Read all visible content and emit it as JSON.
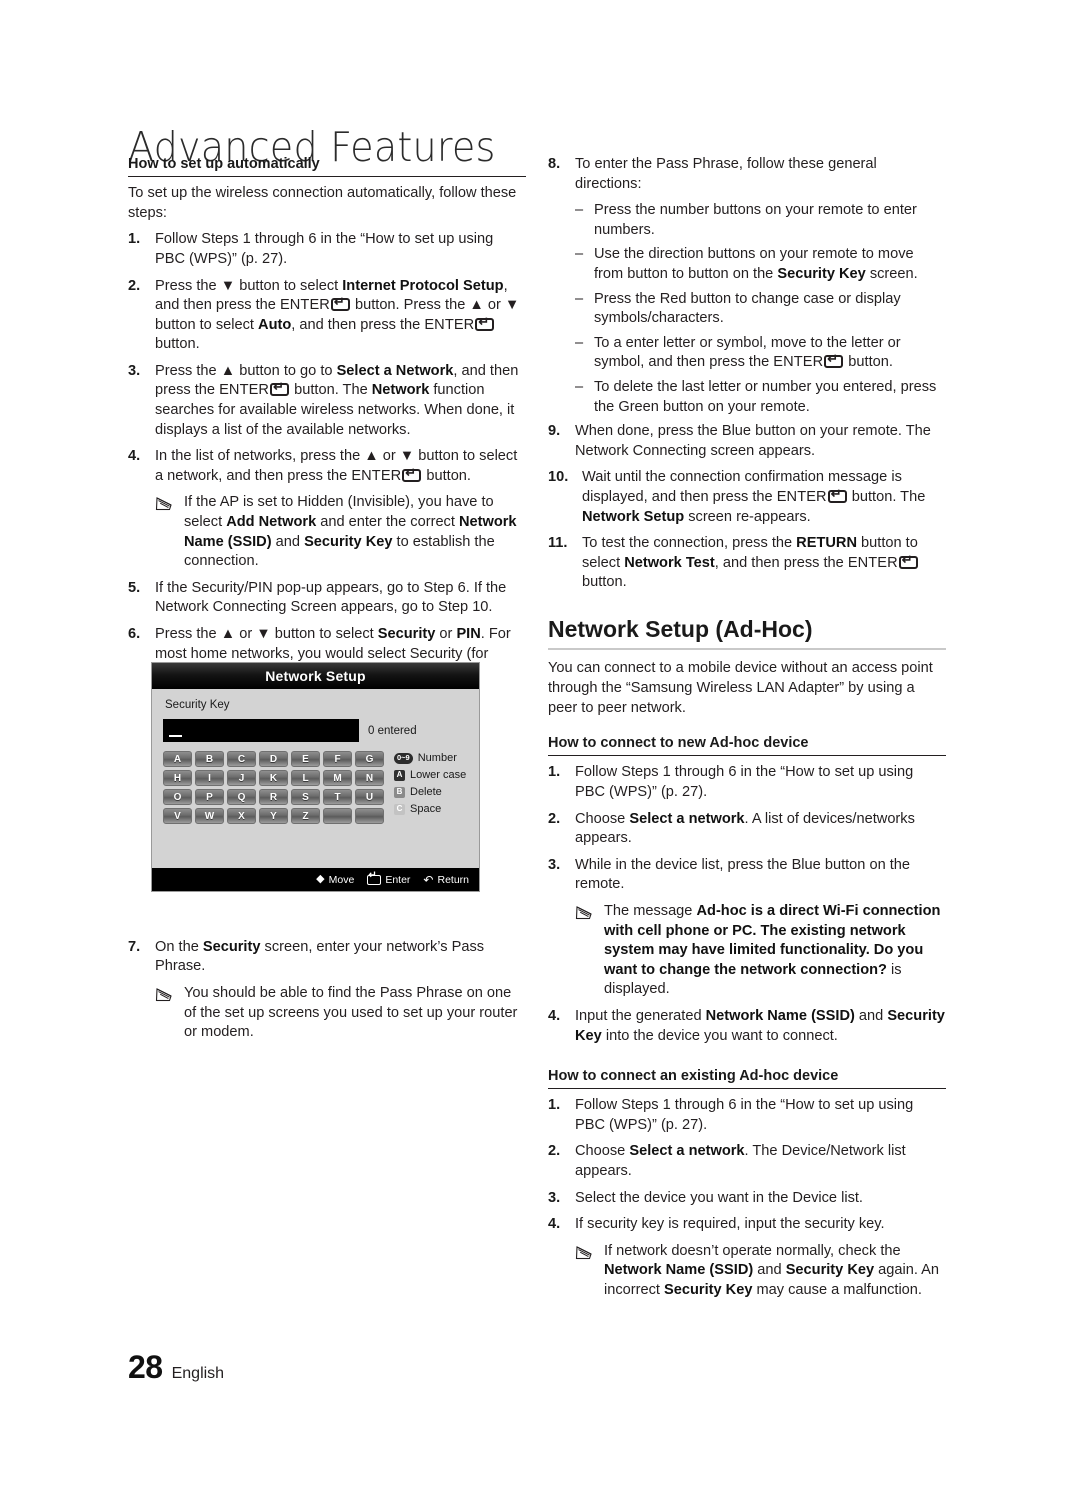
{
  "page": {
    "chapter_title": "Advanced Features",
    "page_number": "28",
    "language": "English"
  },
  "left_column": {
    "section_heading": "How to set up automatically",
    "intro": "To set up the wireless connection automatically, follow these steps:",
    "steps": [
      {
        "num": "1.",
        "text_html": "Follow Steps 1 through 6 in the “How to set up using PBC (WPS)” (p. 27)."
      },
      {
        "num": "2.",
        "text_html": "Press the ▼ button to select <b>Internet Protocol Setup</b>, and then press the <span class=\"ent\">ENTER<span class=\"keyglyph\"></span></span> button. Press the ▲ or ▼ button to select <b>Auto</b>, and then press the <span class=\"ent\">ENTER<span class=\"keyglyph\"></span></span> button."
      },
      {
        "num": "3.",
        "text_html": "Press the ▲ button to go to <b>Select a Network</b>, and then press the <span class=\"ent\">ENTER<span class=\"keyglyph\"></span></span> button. The <b>Network</b> function searches for available wireless networks. When done, it displays a list of the available networks."
      },
      {
        "num": "4.",
        "text_html": "In the list of networks, press the ▲ or ▼ button to select a network, and then press the <span class=\"ent\">ENTER<span class=\"keyglyph\"></span></span> button."
      }
    ],
    "note_after_step4": "If the AP is set to Hidden (Invisible), you have to select <b>Add Network</b> and enter the correct <b>Network Name (SSID)</b> and <b>Security Key</b> to establish the connection.",
    "steps_cont": [
      {
        "num": "5.",
        "text_html": "If the Security/PIN pop-up appears, go to Step 6. If the Network Connecting Screen appears, go to Step 10."
      },
      {
        "num": "6.",
        "text_html": "Press the ▲ or ▼ button to select <b>Security</b> or <b>PIN</b>. For most home networks, you would select Security (for <b>Security Key</b>). The <b>Security</b> Screen appears."
      }
    ],
    "step7": {
      "num": "7.",
      "text_html": "On the <b>Security</b> screen, enter your network’s Pass Phrase."
    },
    "note_after_step7": "You should be able to find the Pass Phrase on one of the set up screens you used to set up your router or modem."
  },
  "osd": {
    "title": "Network Setup",
    "field_label": "Security Key",
    "input_value": "",
    "entered_count": "0 entered",
    "keys": [
      "A",
      "B",
      "C",
      "D",
      "E",
      "F",
      "G",
      "H",
      "I",
      "J",
      "K",
      "L",
      "M",
      "N",
      "O",
      "P",
      "Q",
      "R",
      "S",
      "T",
      "U",
      "V",
      "W",
      "X",
      "Y",
      "Z",
      "",
      ""
    ],
    "legend": [
      {
        "chip": "0~9",
        "chip_style": "pill",
        "label": "Number"
      },
      {
        "chip": "A",
        "chip_style": "a",
        "label": "Lower case"
      },
      {
        "chip": "B",
        "chip_style": "b",
        "label": "Delete"
      },
      {
        "chip": "C",
        "chip_style": "c",
        "label": "Space"
      }
    ],
    "footer": [
      {
        "icon": "dpad-move-icon",
        "label": "Move"
      },
      {
        "icon": "enter-key-icon",
        "label": "Enter"
      },
      {
        "icon": "return-arrow-icon",
        "label": "Return"
      }
    ]
  },
  "right_column": {
    "step8": {
      "num": "8.",
      "text_html": "To enter the Pass Phrase, follow these general directions:"
    },
    "step8_dashes": [
      "Press the number buttons on your remote to enter numbers.",
      "Use the direction buttons on your remote to move from button to button on the <b>Security Key</b> screen.",
      "Press the Red button to change case or display symbols/characters.",
      "To a enter letter or symbol, move to the letter or symbol, and then press the <span class=\"ent\">ENTER<span class=\"keyglyph\"></span></span> button.",
      "To delete the last letter or number you entered, press the Green button on your remote."
    ],
    "steps": [
      {
        "num": "9.",
        "text_html": "When done, press the Blue button on your remote. The Network Connecting screen appears."
      },
      {
        "num": "10.",
        "text_html": "Wait until the connection confirmation message is displayed, and then press the <span class=\"ent\">ENTER<span class=\"keyglyph\"></span></span> button. The <b>Network Setup</b> screen re-appears."
      },
      {
        "num": "11.",
        "text_html": "To test the connection, press the <b>RETURN</b> button to select <b>Network Test</b>, and then press the <span class=\"ent\">ENTER<span class=\"keyglyph\"></span></span> button."
      }
    ],
    "adhoc_heading": "Network Setup (Ad-Hoc)",
    "adhoc_intro": "You can connect to a mobile device without an access point through the “Samsung Wireless LAN Adapter” by using a peer to peer network.",
    "new_device_heading": "How to connect to new Ad-hoc device",
    "new_device_steps": [
      {
        "num": "1.",
        "text_html": "Follow Steps 1 through 6 in the “How to set up using PBC (WPS)” (p. 27)."
      },
      {
        "num": "2.",
        "text_html": "Choose <b>Select a network</b>. A list of devices/networks appears."
      },
      {
        "num": "3.",
        "text_html": "While in the device list, press the Blue button on the remote."
      }
    ],
    "new_device_note": "The message <b>Ad-hoc is a direct Wi-Fi connection with cell phone or PC. The existing network system may have limited functionality. Do you want to change the network connection?</b> is displayed.",
    "new_device_step4": {
      "num": "4.",
      "text_html": "Input the generated <b>Network Name (SSID)</b> and <b>Security Key</b> into the device you want to connect."
    },
    "existing_device_heading": "How to connect an existing Ad-hoc device",
    "existing_device_steps": [
      {
        "num": "1.",
        "text_html": "Follow Steps 1 through 6 in the “How to set up using PBC (WPS)” (p. 27)."
      },
      {
        "num": "2.",
        "text_html": "Choose <b>Select a network</b>. The Device/Network list appears."
      },
      {
        "num": "3.",
        "text_html": "Select the device you want in the Device list."
      },
      {
        "num": "4.",
        "text_html": "If security key is required, input the security key."
      }
    ],
    "existing_device_note": "If network doesn’t operate normally, check the <b>Network Name (SSID)</b> and <b>Security Key</b> again. An incorrect <b>Security Key</b> may cause a malfunction."
  }
}
